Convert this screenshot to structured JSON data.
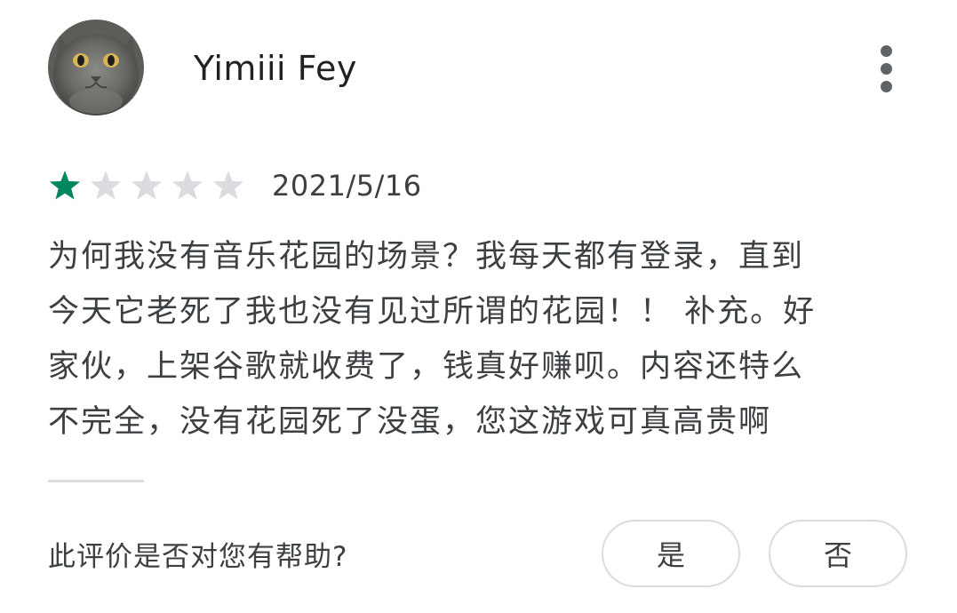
{
  "review": {
    "author": "Yimiii Fey",
    "avatar_icon": "cat-avatar",
    "rating": 1,
    "max_rating": 5,
    "date": "2021/5/16",
    "text_lines": [
      "为何我没有音乐花园的场景？我每天都有登录，直到",
      "今天它老死了我也没有见过所谓的花园！！ 补充。好",
      "家伙，上架谷歌就收费了，钱真好赚呗。内容还特么",
      "不完全，没有花园死了没蛋，您这游戏可真高贵啊"
    ],
    "menu_icon": "more-vert-icon"
  },
  "helpful": {
    "question": "此评价是否对您有帮助?",
    "yes_label": "是",
    "no_label": "否"
  },
  "colors": {
    "star_filled": "#01875f",
    "star_empty": "#dadce0",
    "text": "#3c4043",
    "border": "#dadce0"
  }
}
